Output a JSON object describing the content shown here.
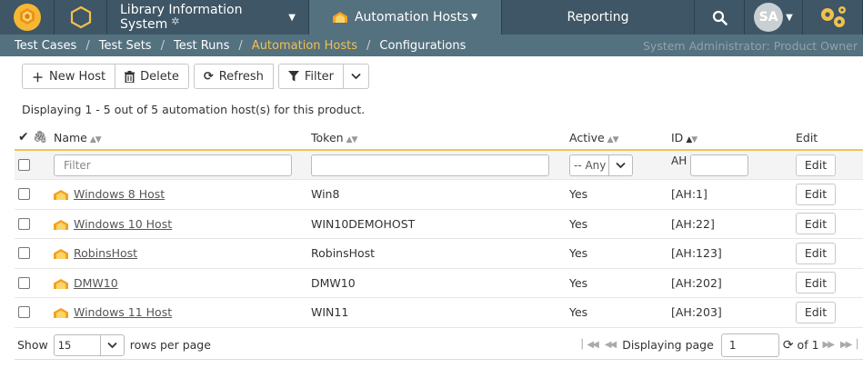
{
  "nav": {
    "project": "Library Information System",
    "active_tab": "Automation Hosts",
    "reporting": "Reporting",
    "avatar": "SA"
  },
  "breadcrumb": {
    "items": [
      "Test Cases",
      "Test Sets",
      "Test Runs",
      "Automation Hosts",
      "Configurations"
    ],
    "user": "System Administrator: Product Owner"
  },
  "toolbar": {
    "new_host": "New Host",
    "delete": "Delete",
    "refresh": "Refresh",
    "filter": "Filter"
  },
  "summary": "Displaying 1 - 5 out of 5 automation host(s) for this product.",
  "table": {
    "headers": {
      "name": "Name",
      "token": "Token",
      "active": "Active",
      "id": "ID",
      "edit": "Edit"
    },
    "filter": {
      "name_placeholder": "Filter",
      "active_value": "-- Any --",
      "id_prefix": "AH",
      "edit_label": "Edit"
    },
    "rows": [
      {
        "name": "Windows 8 Host",
        "token": "Win8",
        "active": "Yes",
        "id": "[AH:1]",
        "edit": "Edit"
      },
      {
        "name": "Windows 10 Host",
        "token": "WIN10DEMOHOST",
        "active": "Yes",
        "id": "[AH:22]",
        "edit": "Edit"
      },
      {
        "name": "RobinsHost",
        "token": "RobinsHost",
        "active": "Yes",
        "id": "[AH:123]",
        "edit": "Edit"
      },
      {
        "name": "DMW10",
        "token": "DMW10",
        "active": "Yes",
        "id": "[AH:202]",
        "edit": "Edit"
      },
      {
        "name": "Windows 11 Host",
        "token": "WIN11",
        "active": "Yes",
        "id": "[AH:203]",
        "edit": "Edit"
      }
    ]
  },
  "footer": {
    "show": "Show",
    "page_size": "15",
    "rows_per_page": "rows per page",
    "displaying_page": "Displaying page",
    "page": "1",
    "of": "of 1"
  },
  "colors": {
    "topbar": "#3e5665",
    "active_tab": "#54717f",
    "accent": "#f3c04e",
    "logo": "#f2a516"
  }
}
